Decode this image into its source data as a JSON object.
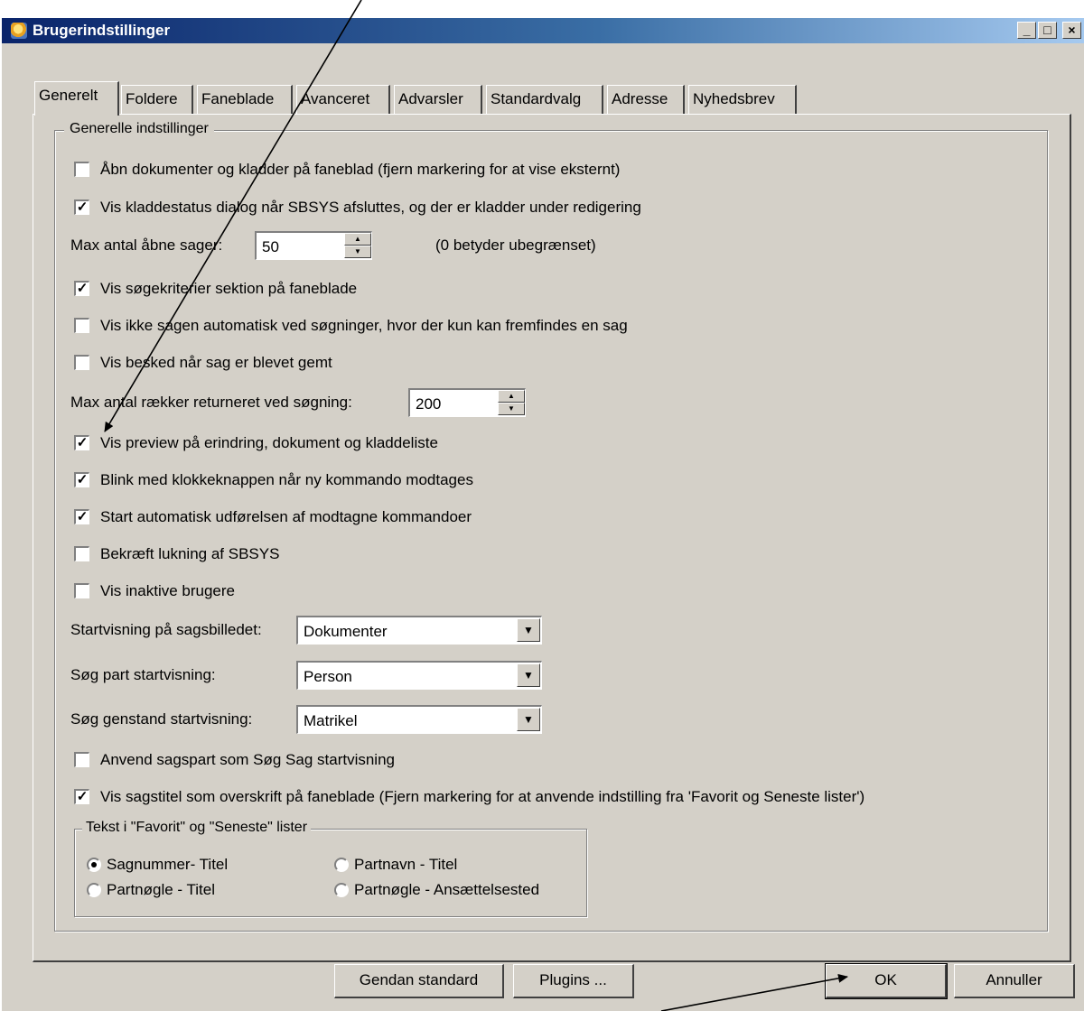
{
  "window": {
    "title": "Brugerindstillinger"
  },
  "titlebar_buttons": {
    "minimize": "_",
    "maximize": "□",
    "close": "×"
  },
  "tabs": [
    "Generelt",
    "Foldere",
    "Faneblade",
    "Avanceret",
    "Advarsler",
    "Standardvalg",
    "Adresse",
    "Nyhedsbrev"
  ],
  "active_tab": "Generelt",
  "general": {
    "group_title": "Generelle indstillinger",
    "checkboxes": [
      {
        "label": "Åbn dokumenter og kladder på faneblad (fjern markering for at vise eksternt)",
        "checked": false
      },
      {
        "label": "Vis kladdestatus dialog når SBSYS afsluttes, og der er kladder under redigering",
        "checked": true
      },
      {
        "label": "Vis søgekriterier sektion på faneblade",
        "checked": true
      },
      {
        "label": "Vis ikke sagen automatisk ved søgninger, hvor der kun kan fremfindes en sag",
        "checked": false
      },
      {
        "label": "Vis besked når sag er blevet gemt",
        "checked": false
      },
      {
        "label": "Vis preview på erindring, dokument og kladdeliste",
        "checked": true
      },
      {
        "label": "Blink med klokkeknappen når ny kommando modtages",
        "checked": true
      },
      {
        "label": "Start automatisk udførelsen af modtagne kommandoer",
        "checked": true
      },
      {
        "label": "Bekræft lukning af SBSYS",
        "checked": false
      },
      {
        "label": "Vis inaktive brugere",
        "checked": false
      },
      {
        "label": "Anvend sagspart som Søg Sag startvisning",
        "checked": false
      },
      {
        "label": "Vis sagstitel som overskrift på faneblade (Fjern markering for at anvende indstilling fra 'Favorit og Seneste lister')",
        "checked": true
      }
    ],
    "check_mark": "✓",
    "max_open_cases": {
      "label": "Max antal åbne sager:",
      "value": "50",
      "note": "(0 betyder ubegrænset)"
    },
    "max_rows": {
      "label": "Max antal rækker returneret ved søgning:",
      "value": "200"
    },
    "spin_up": "▲",
    "spin_down": "▼",
    "combo_arrow": "▼",
    "start_view": {
      "label": "Startvisning på sagsbilledet:",
      "value": "Dokumenter"
    },
    "search_party": {
      "label": "Søg part startvisning:",
      "value": "Person"
    },
    "search_object": {
      "label": "Søg genstand startvisning:",
      "value": "Matrikel"
    },
    "list_text": {
      "group_title": "Tekst i \"Favorit\" og \"Seneste\" lister",
      "options": [
        {
          "label": "Sagnummer- Titel",
          "selected": true
        },
        {
          "label": "Partnavn - Titel",
          "selected": false
        },
        {
          "label": "Partnøgle - Titel",
          "selected": false
        },
        {
          "label": "Partnøgle - Ansættelsested",
          "selected": false
        }
      ]
    }
  },
  "buttons": {
    "restore": "Gendan standard",
    "plugins": "Plugins ...",
    "ok": "OK",
    "cancel": "Annuller"
  }
}
